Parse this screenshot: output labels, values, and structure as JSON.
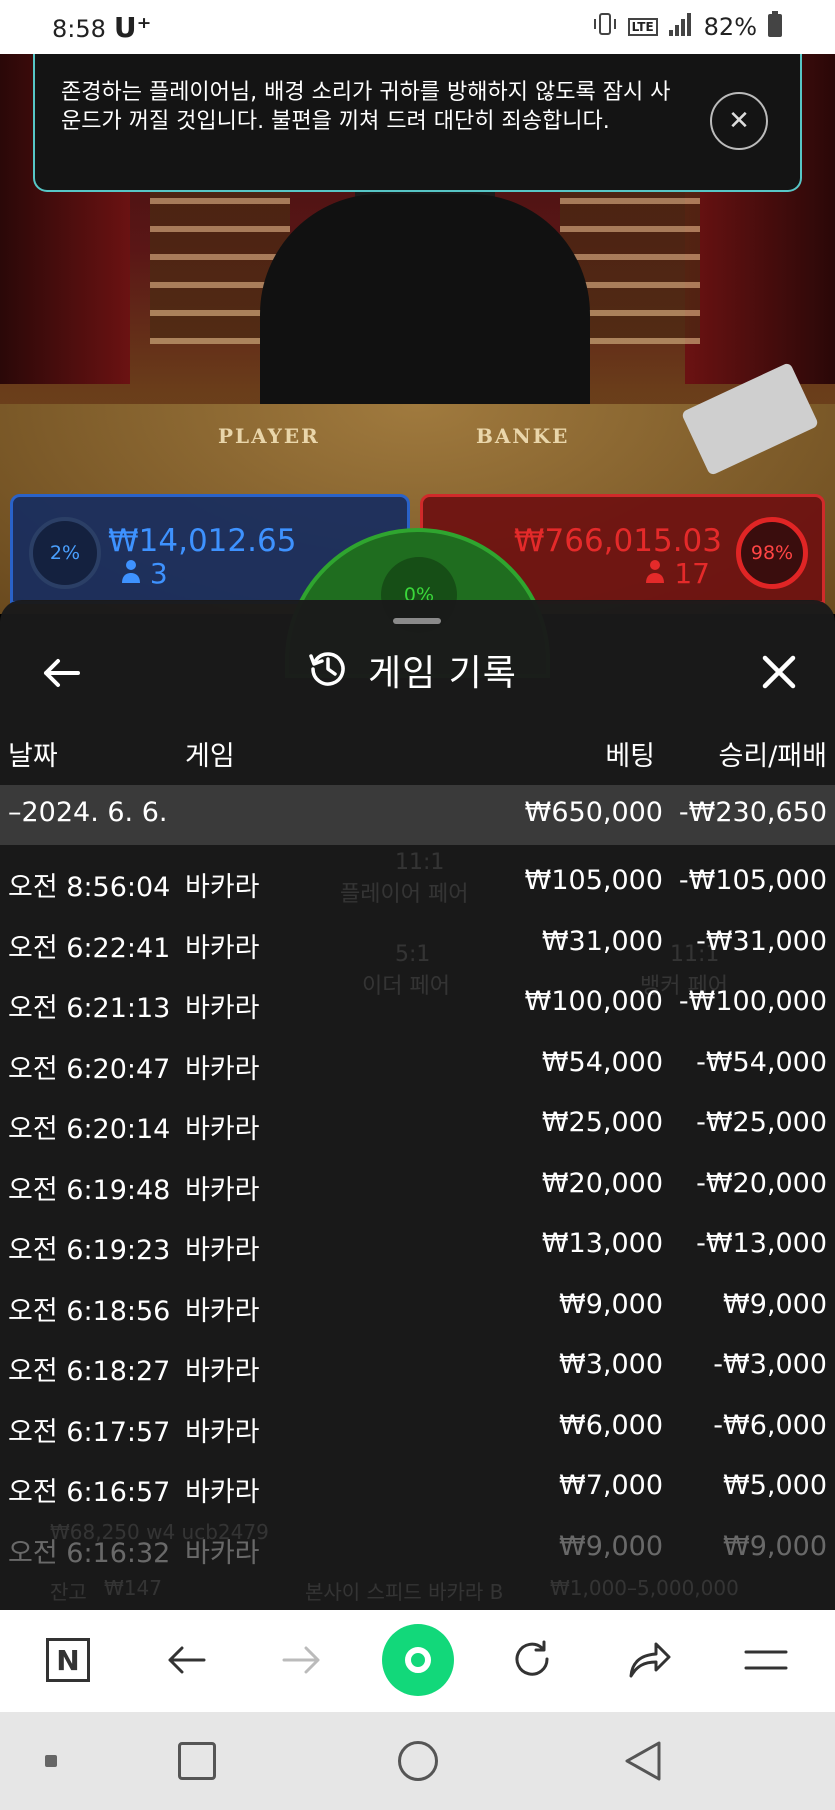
{
  "status_bar": {
    "time": "8:58",
    "carrier": "U⁺",
    "network_badge": "LTE",
    "battery": "82%"
  },
  "notice": {
    "text": "존경하는 플레이어님, 배경 소리가 귀하를 방해하지 않도록 잠시 사운드가 꺼질 것입니다. 불편을 끼쳐 드려 대단히 죄송합니다.",
    "close_glyph": "✕"
  },
  "video": {
    "player_label": "PLAYER",
    "banker_label": "BANKE"
  },
  "bets": {
    "player": {
      "percent": "2%",
      "amount": "₩14,012.65",
      "count": "3"
    },
    "banker": {
      "percent": "98%",
      "amount": "₩766,015.03",
      "count": "17"
    },
    "tie": {
      "percent": "0%"
    }
  },
  "sheet": {
    "title": "게임 기록",
    "back_glyph": "←",
    "close_glyph": "✕",
    "columns": {
      "date": "날짜",
      "game": "게임",
      "bet": "베팅",
      "winloss": "승리/패배"
    },
    "date_row": {
      "date": "–2024. 6. 6.",
      "bet": "₩650,000",
      "winloss": "-₩230,650"
    },
    "rows": [
      {
        "time": "오전 8:56:04",
        "game": "바카라",
        "bet": "₩105,000",
        "winloss": "-₩105,000"
      },
      {
        "time": "오전 6:22:41",
        "game": "바카라",
        "bet": "₩31,000",
        "winloss": "-₩31,000"
      },
      {
        "time": "오전 6:21:13",
        "game": "바카라",
        "bet": "₩100,000",
        "winloss": "-₩100,000"
      },
      {
        "time": "오전 6:20:47",
        "game": "바카라",
        "bet": "₩54,000",
        "winloss": "-₩54,000"
      },
      {
        "time": "오전 6:20:14",
        "game": "바카라",
        "bet": "₩25,000",
        "winloss": "-₩25,000"
      },
      {
        "time": "오전 6:19:48",
        "game": "바카라",
        "bet": "₩20,000",
        "winloss": "-₩20,000"
      },
      {
        "time": "오전 6:19:23",
        "game": "바카라",
        "bet": "₩13,000",
        "winloss": "-₩13,000"
      },
      {
        "time": "오전 6:18:56",
        "game": "바카라",
        "bet": "₩9,000",
        "winloss": "₩9,000"
      },
      {
        "time": "오전 6:18:27",
        "game": "바카라",
        "bet": "₩3,000",
        "winloss": "-₩3,000"
      },
      {
        "time": "오전 6:17:57",
        "game": "바카라",
        "bet": "₩6,000",
        "winloss": "-₩6,000"
      },
      {
        "time": "오전 6:16:57",
        "game": "바카라",
        "bet": "₩7,000",
        "winloss": "₩5,000"
      },
      {
        "time": "오전 6:16:32",
        "game": "바카라",
        "bet": "₩9,000",
        "winloss": "₩9,000"
      }
    ],
    "background_ghost": {
      "line1": "11:1",
      "line2": "플레이어 페어",
      "line3": "5:1",
      "line4": "이더 페어",
      "line5": "11:1",
      "line6": "뱅커 페어",
      "balance_label": "잔고",
      "balance_value": "₩147",
      "table_name": "본사이 스피드 바카라 B",
      "limits": "₩1,000–5,000,000",
      "bet_info": "₩68,250 w4 ucb2479"
    }
  },
  "browser_bar": {
    "n_label": "N",
    "back": "←",
    "forward": "→",
    "reload": "⟳",
    "share": "⇗",
    "menu": "☰"
  },
  "colors": {
    "player_blue": "#3e92ff",
    "banker_red": "#e42a2a",
    "tie_green": "#2fa52f",
    "notice_border": "#57c6c6",
    "naver_green": "#12d87a"
  }
}
